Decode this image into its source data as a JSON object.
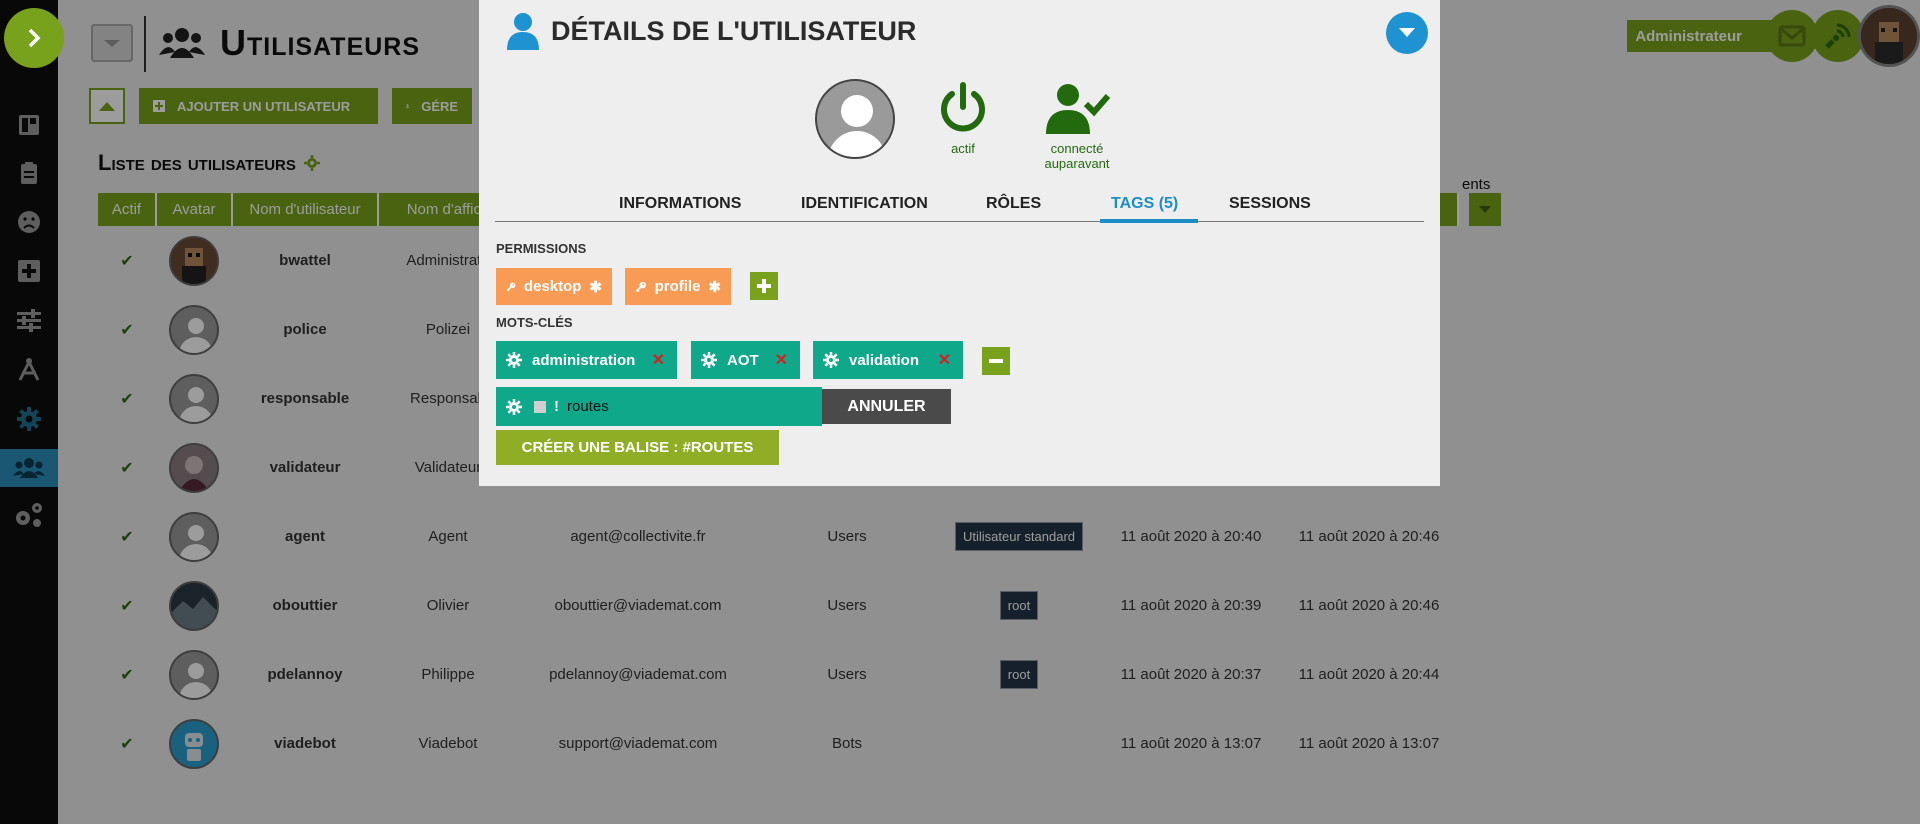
{
  "page": {
    "title": "Utilisateurs",
    "user_label": "Administrateur"
  },
  "toolbar": {
    "add_user": "AJOUTER UN UTILISATEUR",
    "manage_partial": "GÉRE"
  },
  "list": {
    "title": "Liste des utilisateurs",
    "columns": [
      "Actif",
      "Avatar",
      "Nom d'utilisateur",
      "Nom d'affich"
    ],
    "partial_header": "ents",
    "rows": [
      {
        "name": "bwattel",
        "display": "Administrate",
        "email": "",
        "group": "",
        "tag": "",
        "created": "",
        "updated": ""
      },
      {
        "name": "police",
        "display": "Polizei",
        "email": "",
        "group": "",
        "tag": "",
        "created": "",
        "updated": ""
      },
      {
        "name": "responsable",
        "display": "Responsab",
        "email": "",
        "group": "",
        "tag": "",
        "created": "",
        "updated": ""
      },
      {
        "name": "validateur",
        "display": "Validateur",
        "email": "",
        "group": "",
        "tag": "",
        "created": "",
        "updated": ""
      },
      {
        "name": "agent",
        "display": "Agent",
        "email": "agent@collectivite.fr",
        "group": "Users",
        "tag": "Utilisateur standard",
        "created": "11 août 2020 à 20:40",
        "updated": "11 août 2020 à 20:46"
      },
      {
        "name": "obouttier",
        "display": "Olivier",
        "email": "obouttier@viademat.com",
        "group": "Users",
        "tag": "root",
        "created": "11 août 2020 à 20:39",
        "updated": "11 août 2020 à 20:46"
      },
      {
        "name": "pdelannoy",
        "display": "Philippe",
        "email": "pdelannoy@viademat.com",
        "group": "Users",
        "tag": "root",
        "created": "11 août 2020 à 20:37",
        "updated": "11 août 2020 à 20:44"
      },
      {
        "name": "viadebot",
        "display": "Viadebot",
        "email": "support@viademat.com",
        "group": "Bots",
        "tag": "",
        "created": "11 août 2020 à 13:07",
        "updated": "11 août 2020 à 13:07"
      }
    ]
  },
  "modal": {
    "title": "DÉTAILS DE L'UTILISATEUR",
    "status_active": "actif",
    "status_connected_1": "connecté",
    "status_connected_2": "auparavant",
    "tabs": [
      "INFORMATIONS",
      "IDENTIFICATION",
      "RÔLES",
      "TAGS (5)",
      "SESSIONS"
    ],
    "active_tab": "TAGS (5)",
    "permissions_label": "PERMISSIONS",
    "permissions": [
      "desktop",
      "profile"
    ],
    "keywords_label": "MOTS-CLÉS",
    "keywords": [
      "administration",
      "AOT",
      "validation"
    ],
    "input_value": "routes",
    "cancel_label": "ANNULER",
    "create_label": "CRÉER UNE BALISE : #ROUTES"
  },
  "colors": {
    "accent": "#78a21b",
    "modal_blue": "#1f93d1",
    "permission_tag": "#f79b55",
    "keyword_tag": "#0fa88a",
    "remove_x": "#d62020"
  }
}
